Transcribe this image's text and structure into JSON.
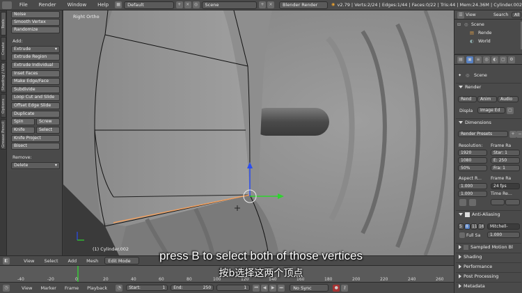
{
  "topbar": {
    "menus": [
      "File",
      "Render",
      "Window",
      "Help"
    ],
    "layout": "Default",
    "scene": "Scene",
    "engine": "Blender Render",
    "stats": "v2.79 | Verts:2/24 | Edges:1/44 | Faces:0/22 | Tris:44 | Mem:24.36M | Cylinder.002"
  },
  "vertical_tabs": [
    "Tools",
    "Create",
    "Shading / UVs",
    "Options",
    "Grease Pencil"
  ],
  "toolshelf": {
    "top_buttons": [
      "Noise",
      "Smooth Vertex",
      "Randomize"
    ],
    "add_label": "Add:",
    "extrude_dropdown": "Extrude",
    "add_buttons": [
      "Extrude Region",
      "Extrude Individual",
      "Inset Faces",
      "Make Edge/Face",
      "Subdivide",
      "Loop Cut and Slide",
      "Offset Edge Slide",
      "Duplicate"
    ],
    "pairs": [
      [
        "Spin",
        "Screw"
      ],
      [
        "Knife",
        "Select"
      ]
    ],
    "more_buttons": [
      "Knife Project",
      "Bisect"
    ],
    "remove_label": "Remove:",
    "delete_dropdown": "Delete"
  },
  "viewport": {
    "view_label": "Right Ortho",
    "object_label": "(1) Cylinder.002"
  },
  "viewport_header": {
    "menus": [
      "View",
      "Select",
      "Add",
      "Mesh"
    ],
    "mode": "Edit Mode"
  },
  "outliner": {
    "view": "View",
    "search": "Search",
    "all": "All",
    "items": [
      "Scene",
      "Rende",
      "World"
    ]
  },
  "properties": {
    "context": "Scene",
    "render_header": "Render",
    "render_btns": [
      "Rend",
      "Anim",
      "Audio"
    ],
    "display_label": "Displa",
    "display_value": "Image Ed",
    "dimensions": "Dimensions",
    "presets": "Render Presets",
    "resolution_label": "Resolution:",
    "frame_range_label": "Frame Ra",
    "res_x": "1920",
    "res_y": "1080",
    "res_pct": "50%",
    "start": "Star: 1",
    "end": "E: 250",
    "frame": "Fra: 1",
    "aspect_label": "Aspect R...",
    "frame_rate_label": "Frame Ra",
    "aspect_x": "1.000",
    "aspect_y": "1.000",
    "fps": "24 fps",
    "time_remap": "Time Re...",
    "aa_header": "Anti-Aliasing",
    "aa_samples": [
      "5",
      "8",
      "11",
      "16"
    ],
    "aa_filter": "Mitchell-",
    "full_sample": "Full Sa",
    "filter_size": "1.000",
    "collapsed_panels": [
      "Sampled Motion Bl",
      "Shading",
      "Performance",
      "Post Processing",
      "Metadata"
    ]
  },
  "timeline": {
    "ticks": [
      "-40",
      "-20",
      "0",
      "20",
      "40",
      "60",
      "80",
      "100",
      "120",
      "140",
      "160",
      "180",
      "200",
      "220",
      "240",
      "260"
    ],
    "menus": [
      "View",
      "Marker",
      "Frame",
      "Playback"
    ],
    "start": "Start:",
    "start_val": "1",
    "end": "End:",
    "end_val": "250",
    "current": "1",
    "sync": "No Sync"
  },
  "subtitles": {
    "en": "press B to select both of those vertices",
    "cn": "按b选择这两个顶点"
  },
  "colors": {
    "accent_blue": "#5680c2",
    "selected_edge": "#f0a060",
    "gizmo_green": "#2fd32f",
    "gizmo_blue": "#2a4df0"
  }
}
